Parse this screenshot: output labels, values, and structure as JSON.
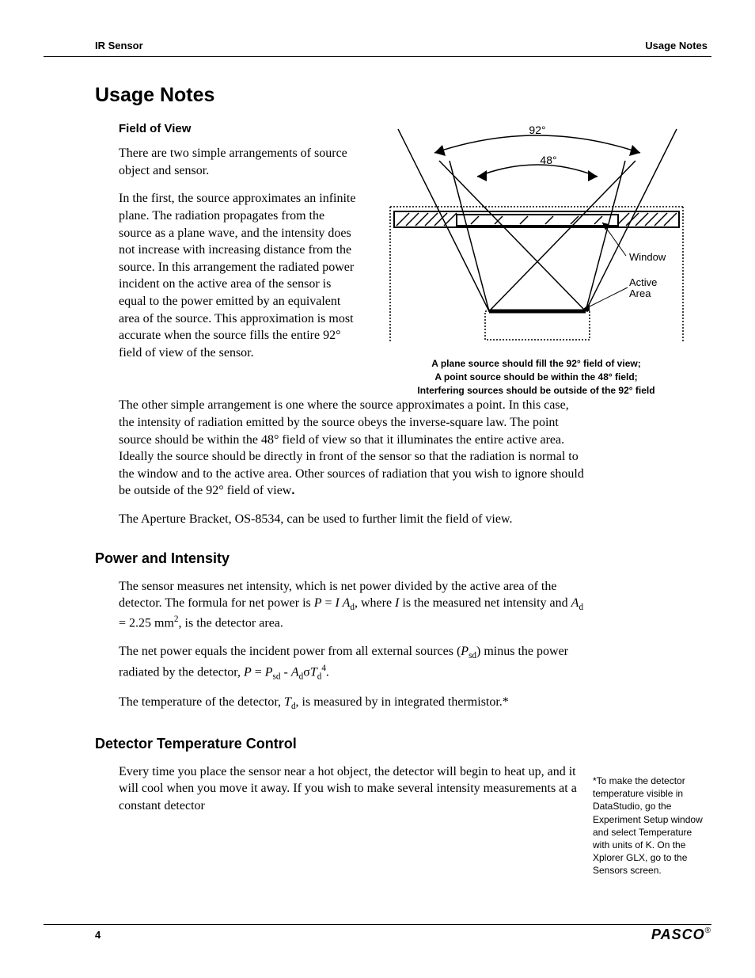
{
  "header": {
    "left": "IR Sensor",
    "right": "Usage Notes"
  },
  "title": "Usage Notes",
  "sections": {
    "fov": {
      "heading": "Field of View",
      "p1": "There are two simple arrangements of source object and sensor.",
      "p2": "In the first, the source approximates an infinite plane. The radiation propagates from the source as a plane wave, and the intensity does not increase with increasing distance from the source. In this arrangement the radiated power incident on the active area of the sensor is equal to the power emitted by an equivalent area of the source. This approximation is most accurate when the source fills the entire 92° field of view of the sensor.",
      "p3": "The other simple arrangement is one where the source approximates a point. In this case, the intensity of radiation emitted by the source obeys the inverse-square law. The point source should be within the 48° field of view so that it illuminates the entire active area. Ideally the source should be directly in front of the sensor so that the radiation is normal to the window and to the active area. Other sources of radiation that you wish to ignore should be outside of the 92° field of view.",
      "p4": "The Aperture Bracket, OS-8534, can be used to further limit the field of view."
    },
    "figure": {
      "label92": "92°",
      "label48": "48°",
      "labelWindow": "Window",
      "labelActive": "Active Area",
      "caption1": "A plane source should fill the 92° field of view;",
      "caption2": "A point source should be within the 48° field;",
      "caption3": "Interfering sources should be outside of the 92° field"
    },
    "power": {
      "heading": "Power and Intensity"
    },
    "detector": {
      "heading": "Detector Temperature Control",
      "p1": "Every time you place the sensor near a hot object, the detector will begin to heat up, and it will cool when you move it away. If you wish to make several intensity measurements at a constant detector"
    }
  },
  "sidenote": "*To make the detector temperature visible in DataStudio, go the Experiment Setup window and select Temperature with units of K. On the Xplorer GLX, go to the Sensors screen.",
  "footer": {
    "page": "4",
    "logo": "PASCO",
    "reg": "®"
  }
}
